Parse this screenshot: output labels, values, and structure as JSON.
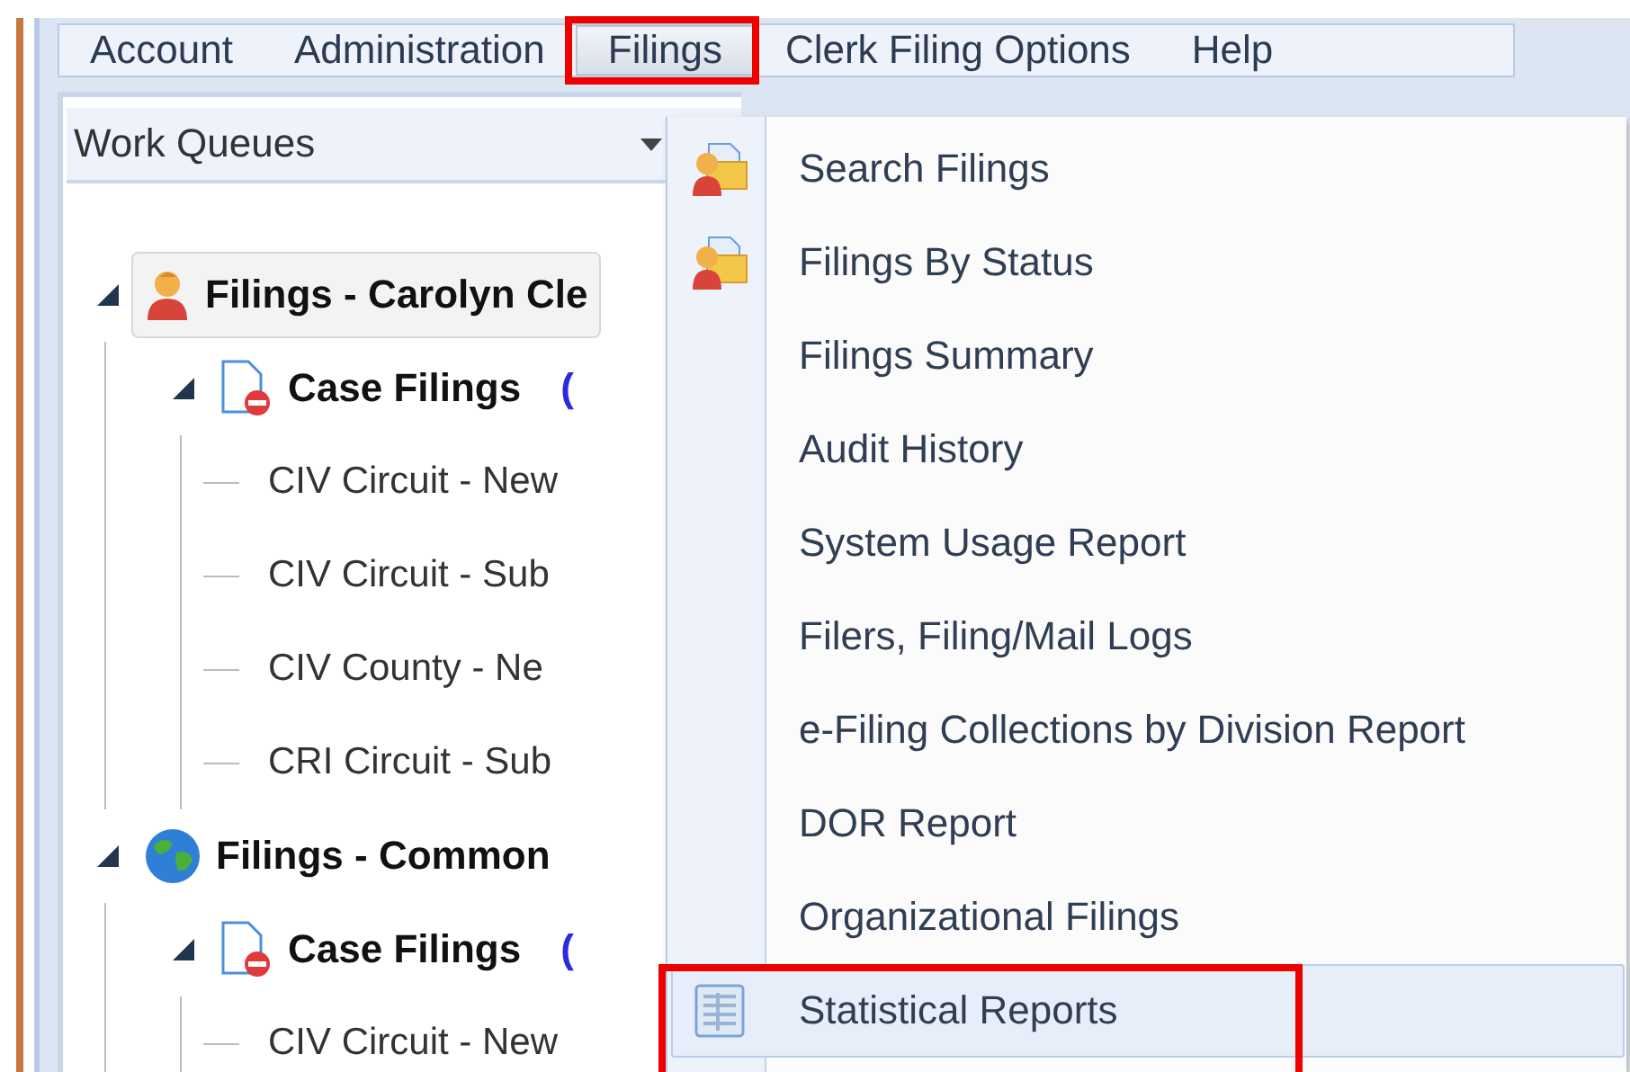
{
  "menu_bar": [
    {
      "label": "Account",
      "selected": false,
      "annotated": false
    },
    {
      "label": "Administration",
      "selected": false,
      "annotated": false
    },
    {
      "label": "Filings",
      "selected": true,
      "annotated": true
    },
    {
      "label": "Clerk Filing Options",
      "selected": false,
      "annotated": false
    },
    {
      "label": "Help",
      "selected": false,
      "annotated": false
    }
  ],
  "queue_selector": {
    "value": "Work Queues"
  },
  "tree": [
    {
      "label": "Filings - Carolyn Cle",
      "kind": "person",
      "expanded": true,
      "selected": true,
      "children": [
        {
          "label": "Case Filings",
          "kind": "document",
          "count": "(",
          "expanded": true,
          "selected": false,
          "children": [
            {
              "label": "CIV Circuit - New",
              "selected": false
            },
            {
              "label": "CIV Circuit - Sub",
              "selected": false
            },
            {
              "label": "CIV County - Ne",
              "selected": false
            },
            {
              "label": "CRI Circuit - Sub",
              "selected": false
            }
          ]
        }
      ]
    },
    {
      "label": "Filings - Common",
      "kind": "globe",
      "expanded": true,
      "selected": false,
      "children": [
        {
          "label": "Case Filings",
          "kind": "document",
          "count": "(",
          "expanded": true,
          "selected": false,
          "children": [
            {
              "label": "CIV Circuit - New",
              "selected": false
            }
          ]
        }
      ]
    }
  ],
  "dropdown": [
    {
      "label": "Search Filings",
      "kind": "person-folder",
      "selected": false,
      "annotated": false
    },
    {
      "label": "Filings By Status",
      "kind": "person-folder",
      "selected": false,
      "annotated": false
    },
    {
      "label": "Filings Summary",
      "selected": false,
      "annotated": false
    },
    {
      "label": "Audit History",
      "selected": false,
      "annotated": false
    },
    {
      "label": "System Usage Report",
      "selected": false,
      "annotated": false
    },
    {
      "label": "Filers, Filing/Mail Logs",
      "selected": false,
      "annotated": false
    },
    {
      "label": "e-Filing Collections by Division Report",
      "selected": false,
      "annotated": false
    },
    {
      "label": "DOR Report",
      "selected": false,
      "annotated": false
    },
    {
      "label": "Organizational Filings",
      "selected": false,
      "annotated": false
    },
    {
      "label": "Statistical Reports",
      "kind": "table",
      "selected": true,
      "annotated": true
    }
  ]
}
